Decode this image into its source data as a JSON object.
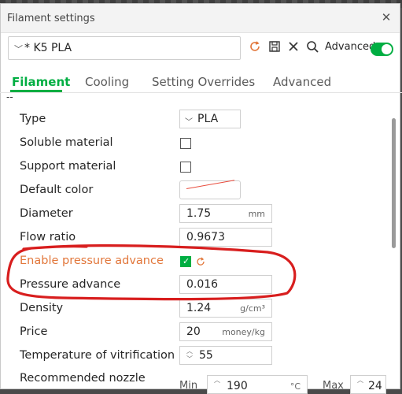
{
  "window": {
    "title": "Filament settings"
  },
  "preset": {
    "name": "* K5 PLA",
    "advanced_label": "Advanced",
    "advanced_on": true
  },
  "tabs": [
    {
      "label": "Filament",
      "active": true
    },
    {
      "label": "Cooling",
      "active": false
    },
    {
      "label": "Setting Overrides",
      "active": false
    },
    {
      "label": "Advanced",
      "active": false
    }
  ],
  "section_marker": "--",
  "rows": {
    "type": {
      "label": "Type",
      "value": "PLA"
    },
    "soluble": {
      "label": "Soluble material",
      "checked": false
    },
    "support": {
      "label": "Support material",
      "checked": false
    },
    "default_color": {
      "label": "Default color",
      "color": "#e84a3b"
    },
    "diameter": {
      "label": "Diameter",
      "value": "1.75",
      "unit": "mm"
    },
    "flow_ratio": {
      "label": "Flow ratio",
      "value": "0.9673"
    },
    "enable_pa": {
      "label": "Enable pressure advance",
      "checked": true
    },
    "pressure_advance": {
      "label": "Pressure advance",
      "value": "0.016"
    },
    "density": {
      "label": "Density",
      "value": "1.24",
      "unit": "g/cm³"
    },
    "price": {
      "label": "Price",
      "value": "20",
      "unit": "money/kg"
    },
    "vitrification": {
      "label": "Temperature of vitrification",
      "value": "55"
    },
    "nozzle": {
      "label": "Recommended nozzle",
      "min_label": "Min",
      "min_value": "190",
      "min_unit": "°C",
      "max_label": "Max",
      "max_value": "24"
    }
  },
  "colors": {
    "accent": "#00ae42",
    "modified": "#e2773b",
    "annotation": "#d81e1e"
  }
}
